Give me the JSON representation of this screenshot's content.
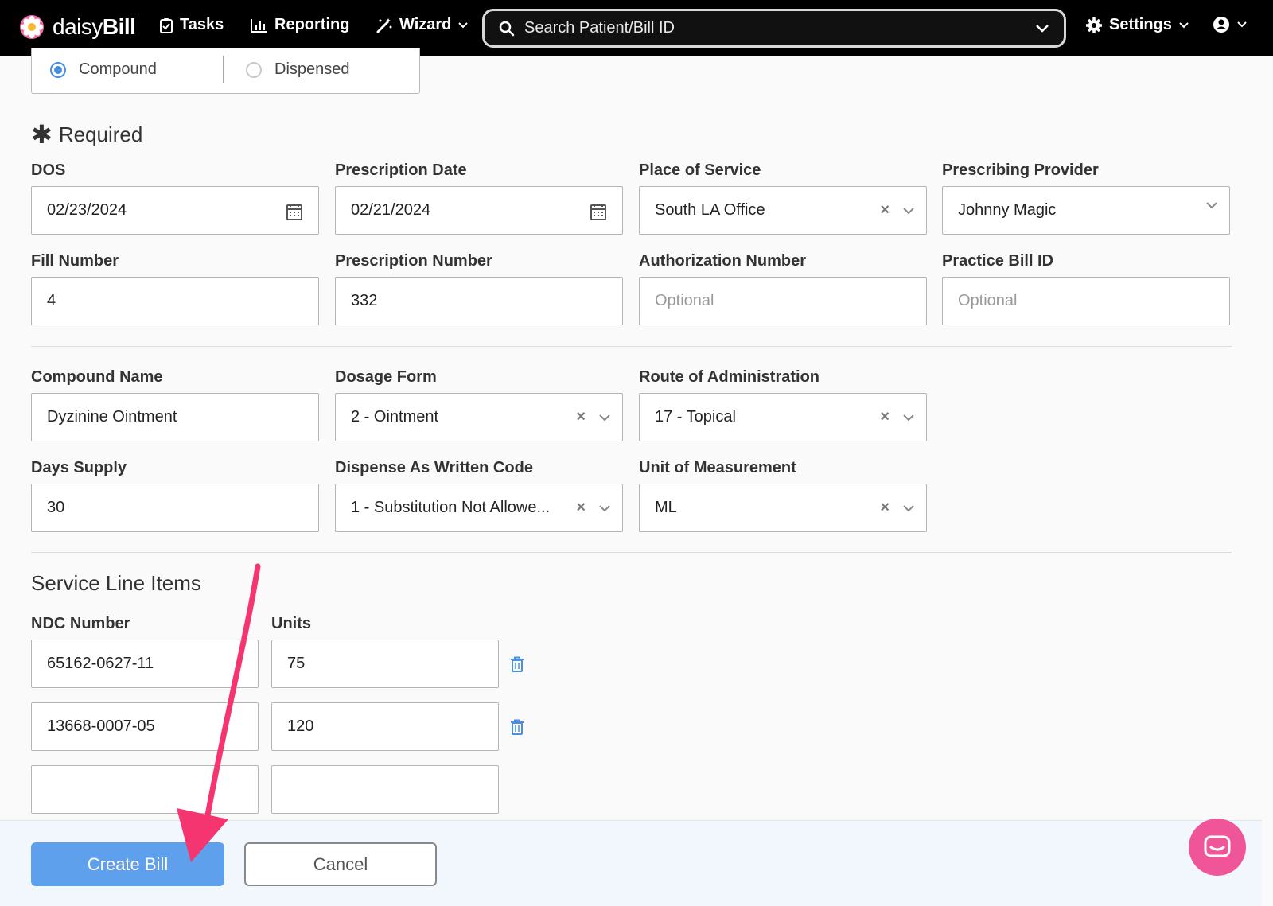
{
  "nav": {
    "logo_prefix": "daisy",
    "logo_suffix": "Bill",
    "tasks": "Tasks",
    "reporting": "Reporting",
    "wizard": "Wizard",
    "search_placeholder": "Search Patient/Bill ID",
    "settings": "Settings"
  },
  "type_toggle": {
    "compound": "Compound",
    "dispensed": "Dispensed",
    "selected": "Compound"
  },
  "required": {
    "title": "Required",
    "dos": {
      "label": "DOS",
      "value": "02/23/2024"
    },
    "prescription_date": {
      "label": "Prescription Date",
      "value": "02/21/2024"
    },
    "place_of_service": {
      "label": "Place of Service",
      "value": "South LA Office"
    },
    "prescribing_provider": {
      "label": "Prescribing Provider",
      "value": "Johnny Magic"
    },
    "fill_number": {
      "label": "Fill Number",
      "value": "4"
    },
    "prescription_number": {
      "label": "Prescription Number",
      "value": "332"
    },
    "authorization_number": {
      "label": "Authorization Number",
      "placeholder": "Optional"
    },
    "practice_bill_id": {
      "label": "Practice Bill ID",
      "placeholder": "Optional"
    }
  },
  "compound": {
    "compound_name": {
      "label": "Compound Name",
      "value": "Dyzinine Ointment"
    },
    "dosage_form": {
      "label": "Dosage Form",
      "value": "2 - Ointment"
    },
    "route": {
      "label": "Route of Administration",
      "value": "17 - Topical"
    },
    "days_supply": {
      "label": "Days Supply",
      "value": "30"
    },
    "daw_code": {
      "label": "Dispense As Written Code",
      "value": "1 - Substitution Not Allowe..."
    },
    "unit": {
      "label": "Unit of Measurement",
      "value": "ML"
    }
  },
  "service_lines": {
    "title": "Service Line Items",
    "ndc_label": "NDC Number",
    "units_label": "Units",
    "rows": [
      {
        "ndc": "65162-0627-11",
        "units": "75"
      },
      {
        "ndc": "13668-0007-05",
        "units": "120"
      },
      {
        "ndc": "",
        "units": ""
      }
    ]
  },
  "footer": {
    "create": "Create Bill",
    "cancel": "Cancel"
  },
  "colors": {
    "accent": "#5ea0ec",
    "annotation_arrow": "#f5356f",
    "chat": "#f0559a"
  }
}
